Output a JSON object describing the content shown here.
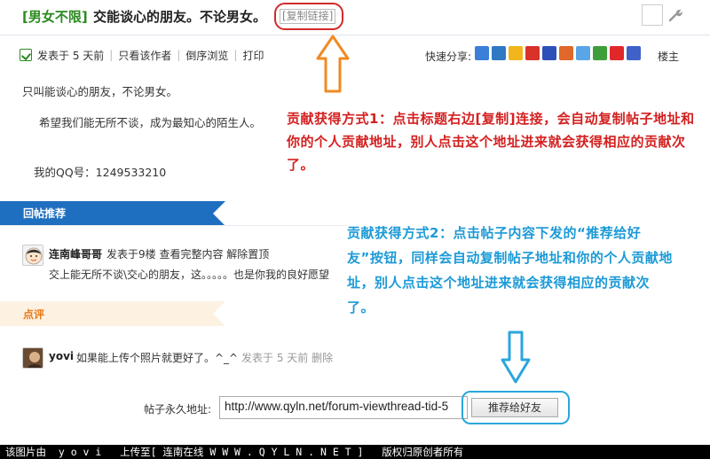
{
  "title": {
    "tag": "[男女不限]",
    "text": "交能谈心的朋友。不论男女。",
    "copy_link": "[复制链接]"
  },
  "meta": {
    "posted": "发表于 5 天前",
    "only_author": "只看该作者",
    "reverse": "倒序浏览",
    "print": "打印",
    "share_label": "快速分享:",
    "owner": "楼主"
  },
  "post": {
    "line1": "只叫能谈心的朋友，不论男女。",
    "line2": "希望我们能无所不谈，成为最知心的陌生人。",
    "line3": "我的QQ号：1249533210"
  },
  "annotation1": "贡献获得方式1：点击标题右边[复制]连接，会自动复制帖子地址和你的个人贡献地址，别人点击这个地址进来就会获得相应的贡献次了。",
  "reply_section": {
    "label": "回帖推荐",
    "user": "连南峰哥哥",
    "meta": "发表于9楼  查看完整内容  解除置顶",
    "text": "交上能无所不谈\\交心的朋友，这。。。。。也是你我的良好愿望"
  },
  "annotation2": "贡献获得方式2：点击帖子内容下发的“推荐给好友”按钮，同样会自动复制帖子地址和你的个人贡献地址，别人点击这个地址进来就会获得相应的贡献次了。",
  "comment_section": {
    "label": "点评",
    "user": "yovi",
    "text": "如果能上传个照片就更好了。^_^",
    "time": "发表于 5 天前 删除"
  },
  "permalink": {
    "label": "帖子永久地址:",
    "url": "http://www.qyln.net/forum-viewthread-tid-5",
    "button": "推荐给好友"
  },
  "footer": "该图片由  y o v i   上传至[ 连南在线 W W W . Q Y L N . N E T ]   版权归原创者所有",
  "colors": {
    "tag_green": "#2b8a1f",
    "annotation_red": "#d42020",
    "annotation_blue": "#1c9ad6",
    "band_blue": "#1f6fc1",
    "band_orange_bg": "#fdf1e2",
    "arrow_orange": "#f08a20"
  }
}
